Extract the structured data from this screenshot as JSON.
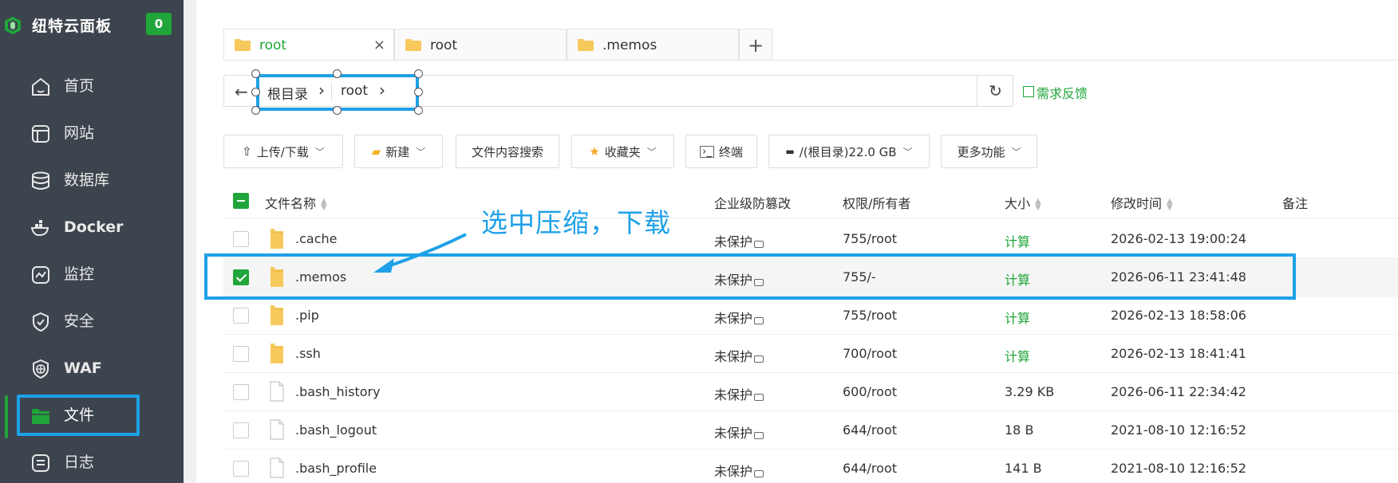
{
  "brand": {
    "name": "纽特云面板",
    "badge": "0"
  },
  "sidebar": {
    "items": [
      {
        "label": "首页",
        "icon": "home-icon"
      },
      {
        "label": "网站",
        "icon": "website-icon"
      },
      {
        "label": "数据库",
        "icon": "database-icon"
      },
      {
        "label": "Docker",
        "icon": "docker-icon"
      },
      {
        "label": "监控",
        "icon": "monitor-icon"
      },
      {
        "label": "安全",
        "icon": "shield-icon"
      },
      {
        "label": "WAF",
        "icon": "waf-icon"
      },
      {
        "label": "文件",
        "icon": "folder-icon",
        "active": true
      },
      {
        "label": "日志",
        "icon": "log-icon"
      }
    ]
  },
  "tabs": [
    {
      "label": "root",
      "active": true
    },
    {
      "label": "root",
      "active": false
    },
    {
      "label": ".memos",
      "active": false
    }
  ],
  "tab_add": "+",
  "tab_close": "×",
  "path": {
    "crumbs": [
      "根目录",
      "root"
    ],
    "back": "←",
    "refresh": "↻"
  },
  "feedback": "需求反馈",
  "toolbar": {
    "upload": "上传/下载",
    "new": "新建",
    "search": "文件内容搜索",
    "favorites": "收藏夹",
    "terminal": "终端",
    "disk": "/(根目录)22.0 GB",
    "more": "更多功能"
  },
  "table": {
    "headers": {
      "name": "文件名称",
      "protect": "企业级防篡改",
      "perm": "权限/所有者",
      "size": "大小",
      "mtime": "修改时间",
      "note": "备注"
    },
    "rows": [
      {
        "name": ".cache",
        "type": "folder",
        "protect": "未保护",
        "perm": "755/root",
        "size": "计算",
        "mtime": "2026-02-13 19:00:24",
        "checked": false
      },
      {
        "name": ".memos",
        "type": "folder",
        "protect": "未保护",
        "perm": "755/-",
        "size": "计算",
        "mtime": "2026-06-11 23:41:48",
        "checked": true
      },
      {
        "name": ".pip",
        "type": "folder",
        "protect": "未保护",
        "perm": "755/root",
        "size": "计算",
        "mtime": "2026-02-13 18:58:06",
        "checked": false
      },
      {
        "name": ".ssh",
        "type": "folder",
        "protect": "未保护",
        "perm": "700/root",
        "size": "计算",
        "mtime": "2026-02-13 18:41:41",
        "checked": false
      },
      {
        "name": ".bash_history",
        "type": "file",
        "protect": "未保护",
        "perm": "600/root",
        "size": "3.29 KB",
        "mtime": "2026-06-11 22:34:42",
        "checked": false
      },
      {
        "name": ".bash_logout",
        "type": "file",
        "protect": "未保护",
        "perm": "644/root",
        "size": "18 B",
        "mtime": "2021-08-10 12:16:52",
        "checked": false
      },
      {
        "name": ".bash_profile",
        "type": "file",
        "protect": "未保护",
        "perm": "644/root",
        "size": "141 B",
        "mtime": "2021-08-10 12:16:52",
        "checked": false
      }
    ]
  },
  "annotation": {
    "text": "选中压缩，下载"
  },
  "colors": {
    "accent": "#20a53a",
    "annotation": "#1ea1e8",
    "sidebar_bg": "#3c444d"
  }
}
